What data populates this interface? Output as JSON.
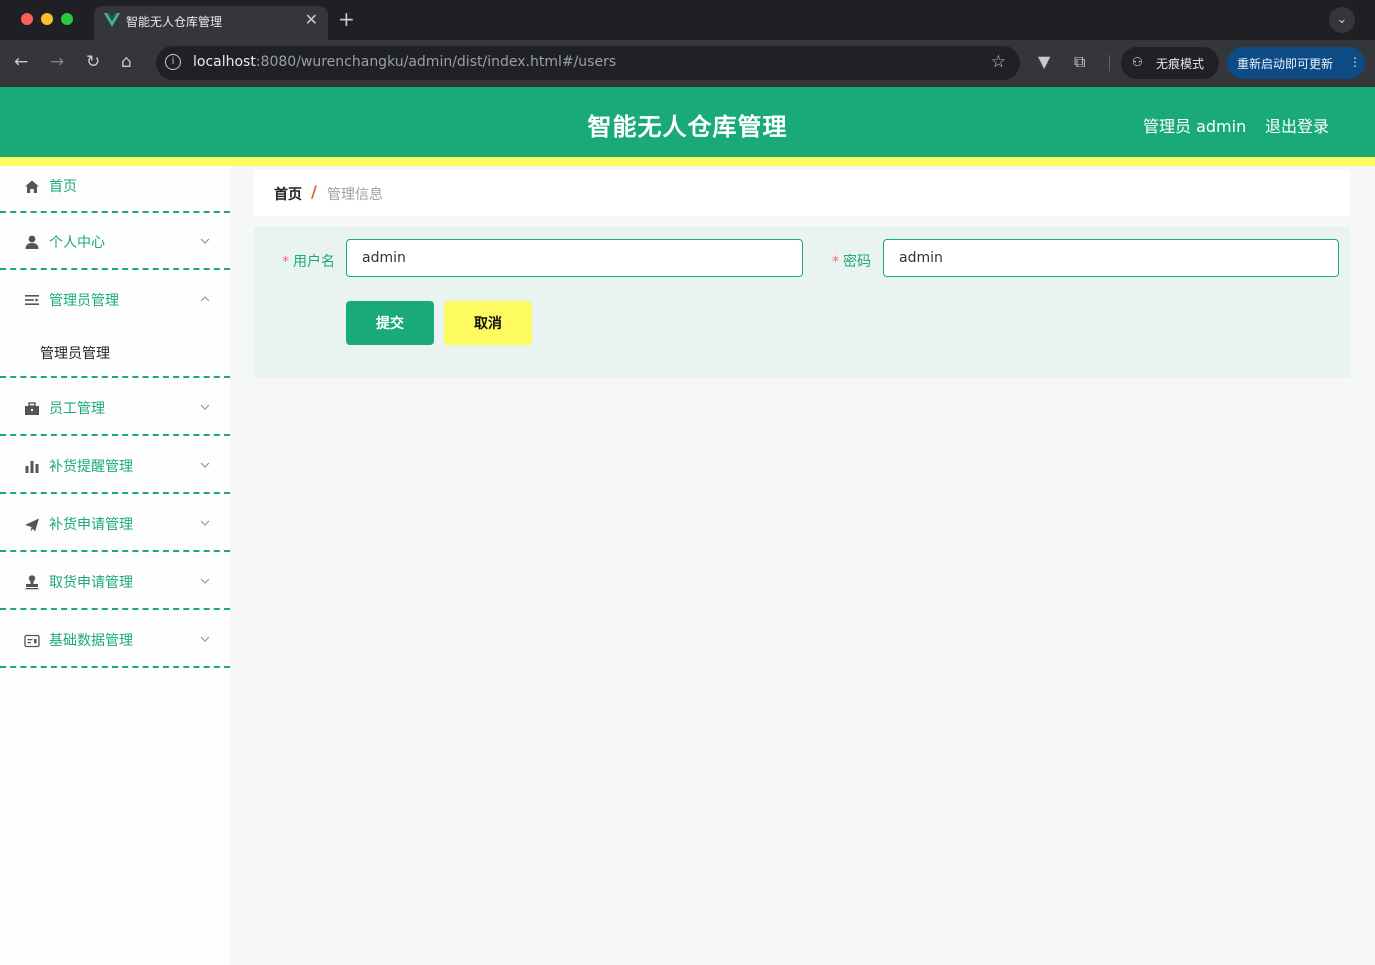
{
  "browser": {
    "tab_title": "智能无人仓库管理",
    "tab_close": "✕",
    "new_tab": "+",
    "url_host": "localhost",
    "url_path": ":8080/wurenchangku/admin/dist/index.html#/users",
    "incognito_label": "无痕模式",
    "update_label": "重新启动即可更新"
  },
  "header": {
    "title": "智能无人仓库管理",
    "admin_label": "管理员 admin",
    "logout_label": "退出登录"
  },
  "sidebar": {
    "items": [
      {
        "label": "首页",
        "icon": "home-icon"
      },
      {
        "label": "个人中心",
        "icon": "user-icon"
      },
      {
        "label": "管理员管理",
        "icon": "list-icon",
        "expanded": true,
        "children": [
          {
            "label": "管理员管理"
          }
        ]
      },
      {
        "label": "员工管理",
        "icon": "briefcase-icon"
      },
      {
        "label": "补货提醒管理",
        "icon": "bar-chart-icon"
      },
      {
        "label": "补货申请管理",
        "icon": "send-icon"
      },
      {
        "label": "取货申请管理",
        "icon": "stamp-icon"
      },
      {
        "label": "基础数据管理",
        "icon": "card-icon"
      }
    ]
  },
  "breadcrumb": {
    "home": "首页",
    "separator": "/",
    "current": "管理信息"
  },
  "form": {
    "username_label": "用户名",
    "username_value": "admin",
    "password_label": "密码",
    "password_value": "admin",
    "required_mark": "*",
    "submit_label": "提交",
    "cancel_label": "取消"
  },
  "colors": {
    "primary": "#1aaa7a",
    "accent_yellow": "#fdfb60",
    "required": "#f56c6c"
  }
}
